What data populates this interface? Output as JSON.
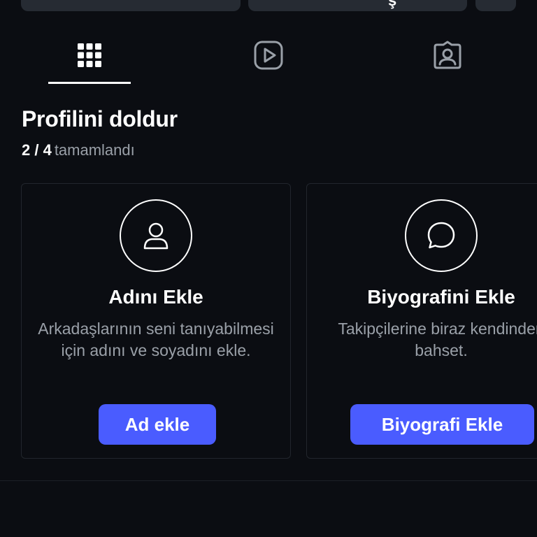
{
  "colors": {
    "background": "#0b0d12",
    "accent": "#4a5cff",
    "muted_text": "#9aa0a8",
    "card_border": "#22262d"
  },
  "top_buttons": [
    {
      "visible_fragment": ""
    },
    {
      "visible_fragment": "ş"
    },
    {
      "visible_fragment": ""
    }
  ],
  "tabs": [
    {
      "icon": "grid-icon",
      "active": true
    },
    {
      "icon": "reels-play-icon",
      "active": false
    },
    {
      "icon": "tagged-person-icon",
      "active": false
    }
  ],
  "profile_completion": {
    "title": "Profilini doldur",
    "count": "2 / 4",
    "status_label": "tamamlandı"
  },
  "cards": [
    {
      "icon": "user-icon",
      "title": "Adını Ekle",
      "description": "Arkadaşlarının seni tanıyabilmesi için adını ve soyadını ekle.",
      "button_label": "Ad ekle"
    },
    {
      "icon": "speech-bubble-icon",
      "title": "Biyografini Ekle",
      "description": "Takipçilerine biraz kendinden bahset.",
      "button_label": "Biyografi Ekle"
    }
  ]
}
